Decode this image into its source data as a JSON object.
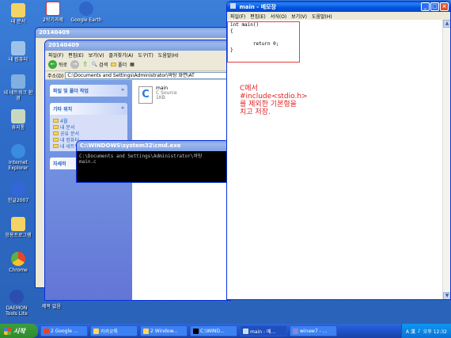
{
  "desktop": {
    "icons": [
      {
        "label": "내 문서"
      },
      {
        "label": "내 컴퓨터"
      },
      {
        "label": "내 네트워크 환경"
      },
      {
        "label": "휴지통"
      },
      {
        "label": "Internet Explorer"
      },
      {
        "label": "한글2007"
      },
      {
        "label": "응용프로그램"
      },
      {
        "label": "Chrome"
      },
      {
        "label": "DAEMON Tools Lite"
      },
      {
        "label": "제목 없음"
      },
      {
        "label": "2학기과제"
      },
      {
        "label": "Google Earth"
      }
    ]
  },
  "explorer_back": {
    "title": "20140409"
  },
  "explorer": {
    "title": "20140409",
    "menu": [
      "파일(F)",
      "편집(E)",
      "보기(V)",
      "즐겨찾기(A)",
      "도구(T)",
      "도움말(H)"
    ],
    "toolbar": {
      "back": "뒤로",
      "search": "검색",
      "folders": "폴더"
    },
    "address_label": "주소(D)",
    "address": "C:\\Documents and Settings\\Administrator\\바탕 화면\\AT",
    "tasks": [
      {
        "title": "파일 및 폴더 작업",
        "items": []
      },
      {
        "title": "기타 위치",
        "items": [
          "4월",
          "내 문서",
          "공유 문서",
          "내 컴퓨터",
          "내 네트워크 환경"
        ]
      },
      {
        "title": "자세히",
        "items": []
      }
    ],
    "file": {
      "name": "main",
      "type": "C Source",
      "size": "1KB"
    }
  },
  "cmd": {
    "title": "C:\\WINDOWS\\system32\\cmd.exe",
    "lines": [
      "",
      "C:\\Documents and Settings\\Administrator\\바탕",
      "main.c"
    ]
  },
  "notepad": {
    "title": "main - 메모장",
    "menu": [
      "파일(F)",
      "편집(E)",
      "서식(O)",
      "보기(V)",
      "도움말(H)"
    ],
    "code": "int main()\n{\n\n        return 0;\n}",
    "note": "C에서\n#include<stdio.h>\n를 제외한 기본형을\n치고 저장."
  },
  "taskbar": {
    "start": "시작",
    "buttons": [
      "2 Google ...",
      "카카오톡",
      "2 Window...",
      "C:\\WIND...",
      "main - 메...",
      "winaw7 - ..."
    ],
    "tray": {
      "lang": "A 漢",
      "time": "오후 12:32"
    }
  },
  "colors": {
    "accent": "#0053e0",
    "note_red": "#e02020",
    "desktop_blue": "#3a6ea5"
  }
}
